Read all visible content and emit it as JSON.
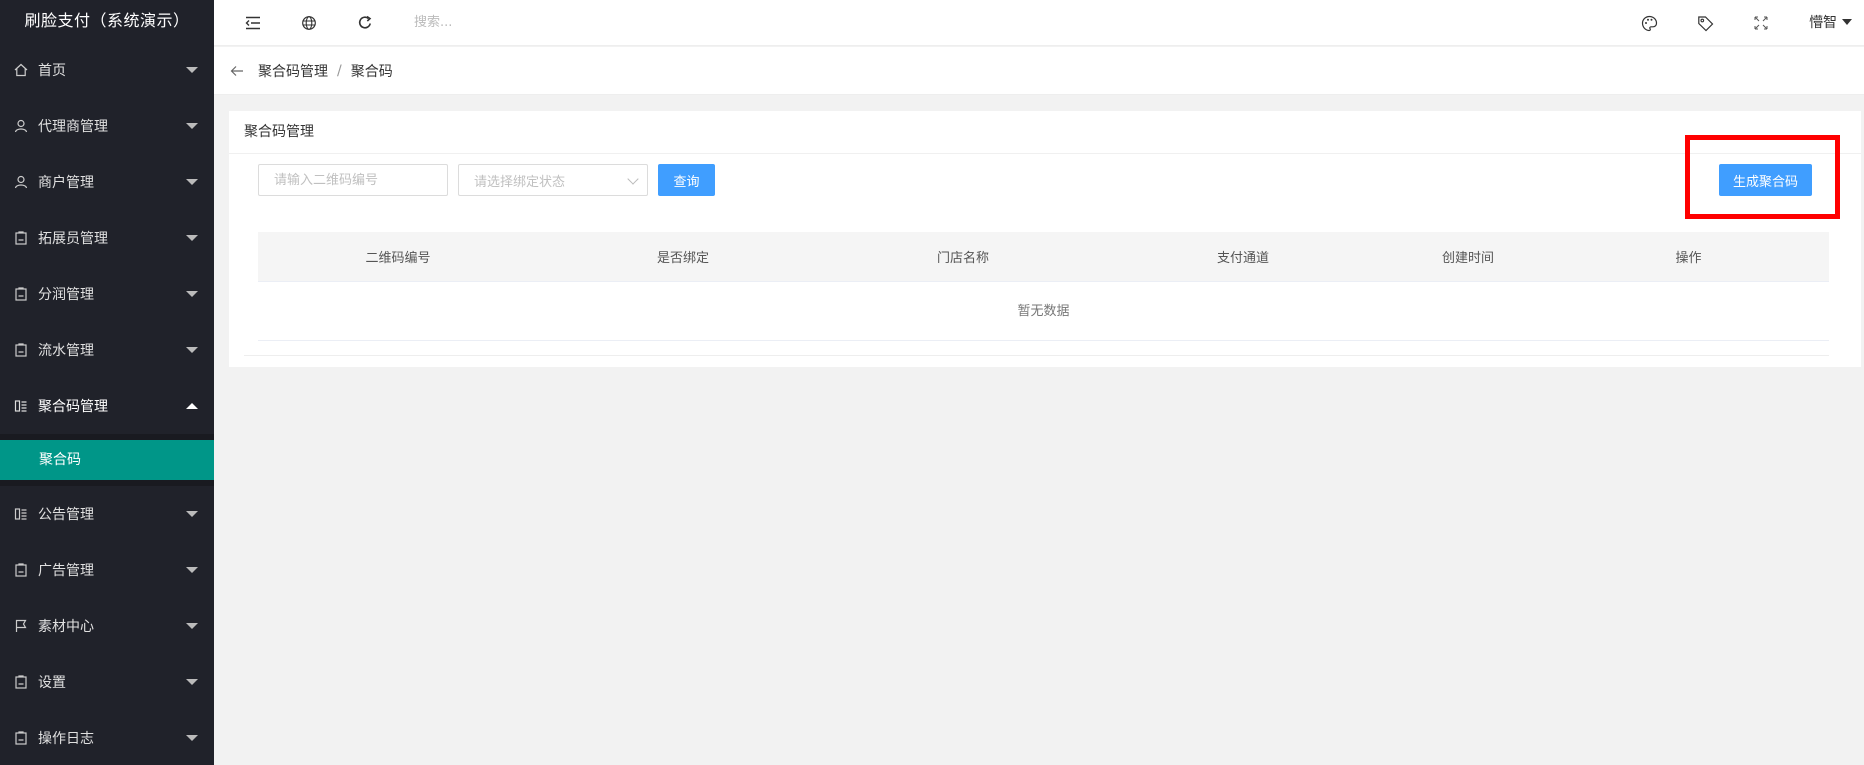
{
  "app": {
    "title": "刷脸支付（系统演示）"
  },
  "sidebar": {
    "items": [
      {
        "label": "首页",
        "icon": "home-icon",
        "open": false
      },
      {
        "label": "代理商管理",
        "icon": "user-icon",
        "open": false
      },
      {
        "label": "商户管理",
        "icon": "user-icon",
        "open": false
      },
      {
        "label": "拓展员管理",
        "icon": "clipboard-icon",
        "open": false
      },
      {
        "label": "分润管理",
        "icon": "clipboard-icon",
        "open": false
      },
      {
        "label": "流水管理",
        "icon": "clipboard-icon",
        "open": false
      },
      {
        "label": "聚合码管理",
        "icon": "list-icon",
        "open": true,
        "children": [
          {
            "label": "聚合码",
            "active": true
          }
        ]
      },
      {
        "label": "公告管理",
        "icon": "list-icon",
        "open": false
      },
      {
        "label": "广告管理",
        "icon": "clipboard-icon",
        "open": false
      },
      {
        "label": "素材中心",
        "icon": "flag-icon",
        "open": false
      },
      {
        "label": "设置",
        "icon": "clipboard-icon",
        "open": false
      },
      {
        "label": "操作日志",
        "icon": "clipboard-icon",
        "open": false
      }
    ]
  },
  "header": {
    "search_placeholder": "搜索...",
    "user_name": "懵智"
  },
  "breadcrumb": {
    "parent": "聚合码管理",
    "separator": "/",
    "current": "聚合码"
  },
  "card": {
    "title": "聚合码管理",
    "qr_input_placeholder": "请输入二维码编号",
    "bind_select_placeholder": "请选择绑定状态",
    "query_button": "查询",
    "generate_button": "生成聚合码"
  },
  "table": {
    "columns": [
      "二维码编号",
      "是否绑定",
      "门店名称",
      "支付通道",
      "创建时间",
      "操作"
    ],
    "empty_text": "暂无数据"
  },
  "colors": {
    "sidebar_bg": "#20222a",
    "active_item": "#009688",
    "primary_button": "#409eff",
    "highlight": "#ff0000"
  }
}
